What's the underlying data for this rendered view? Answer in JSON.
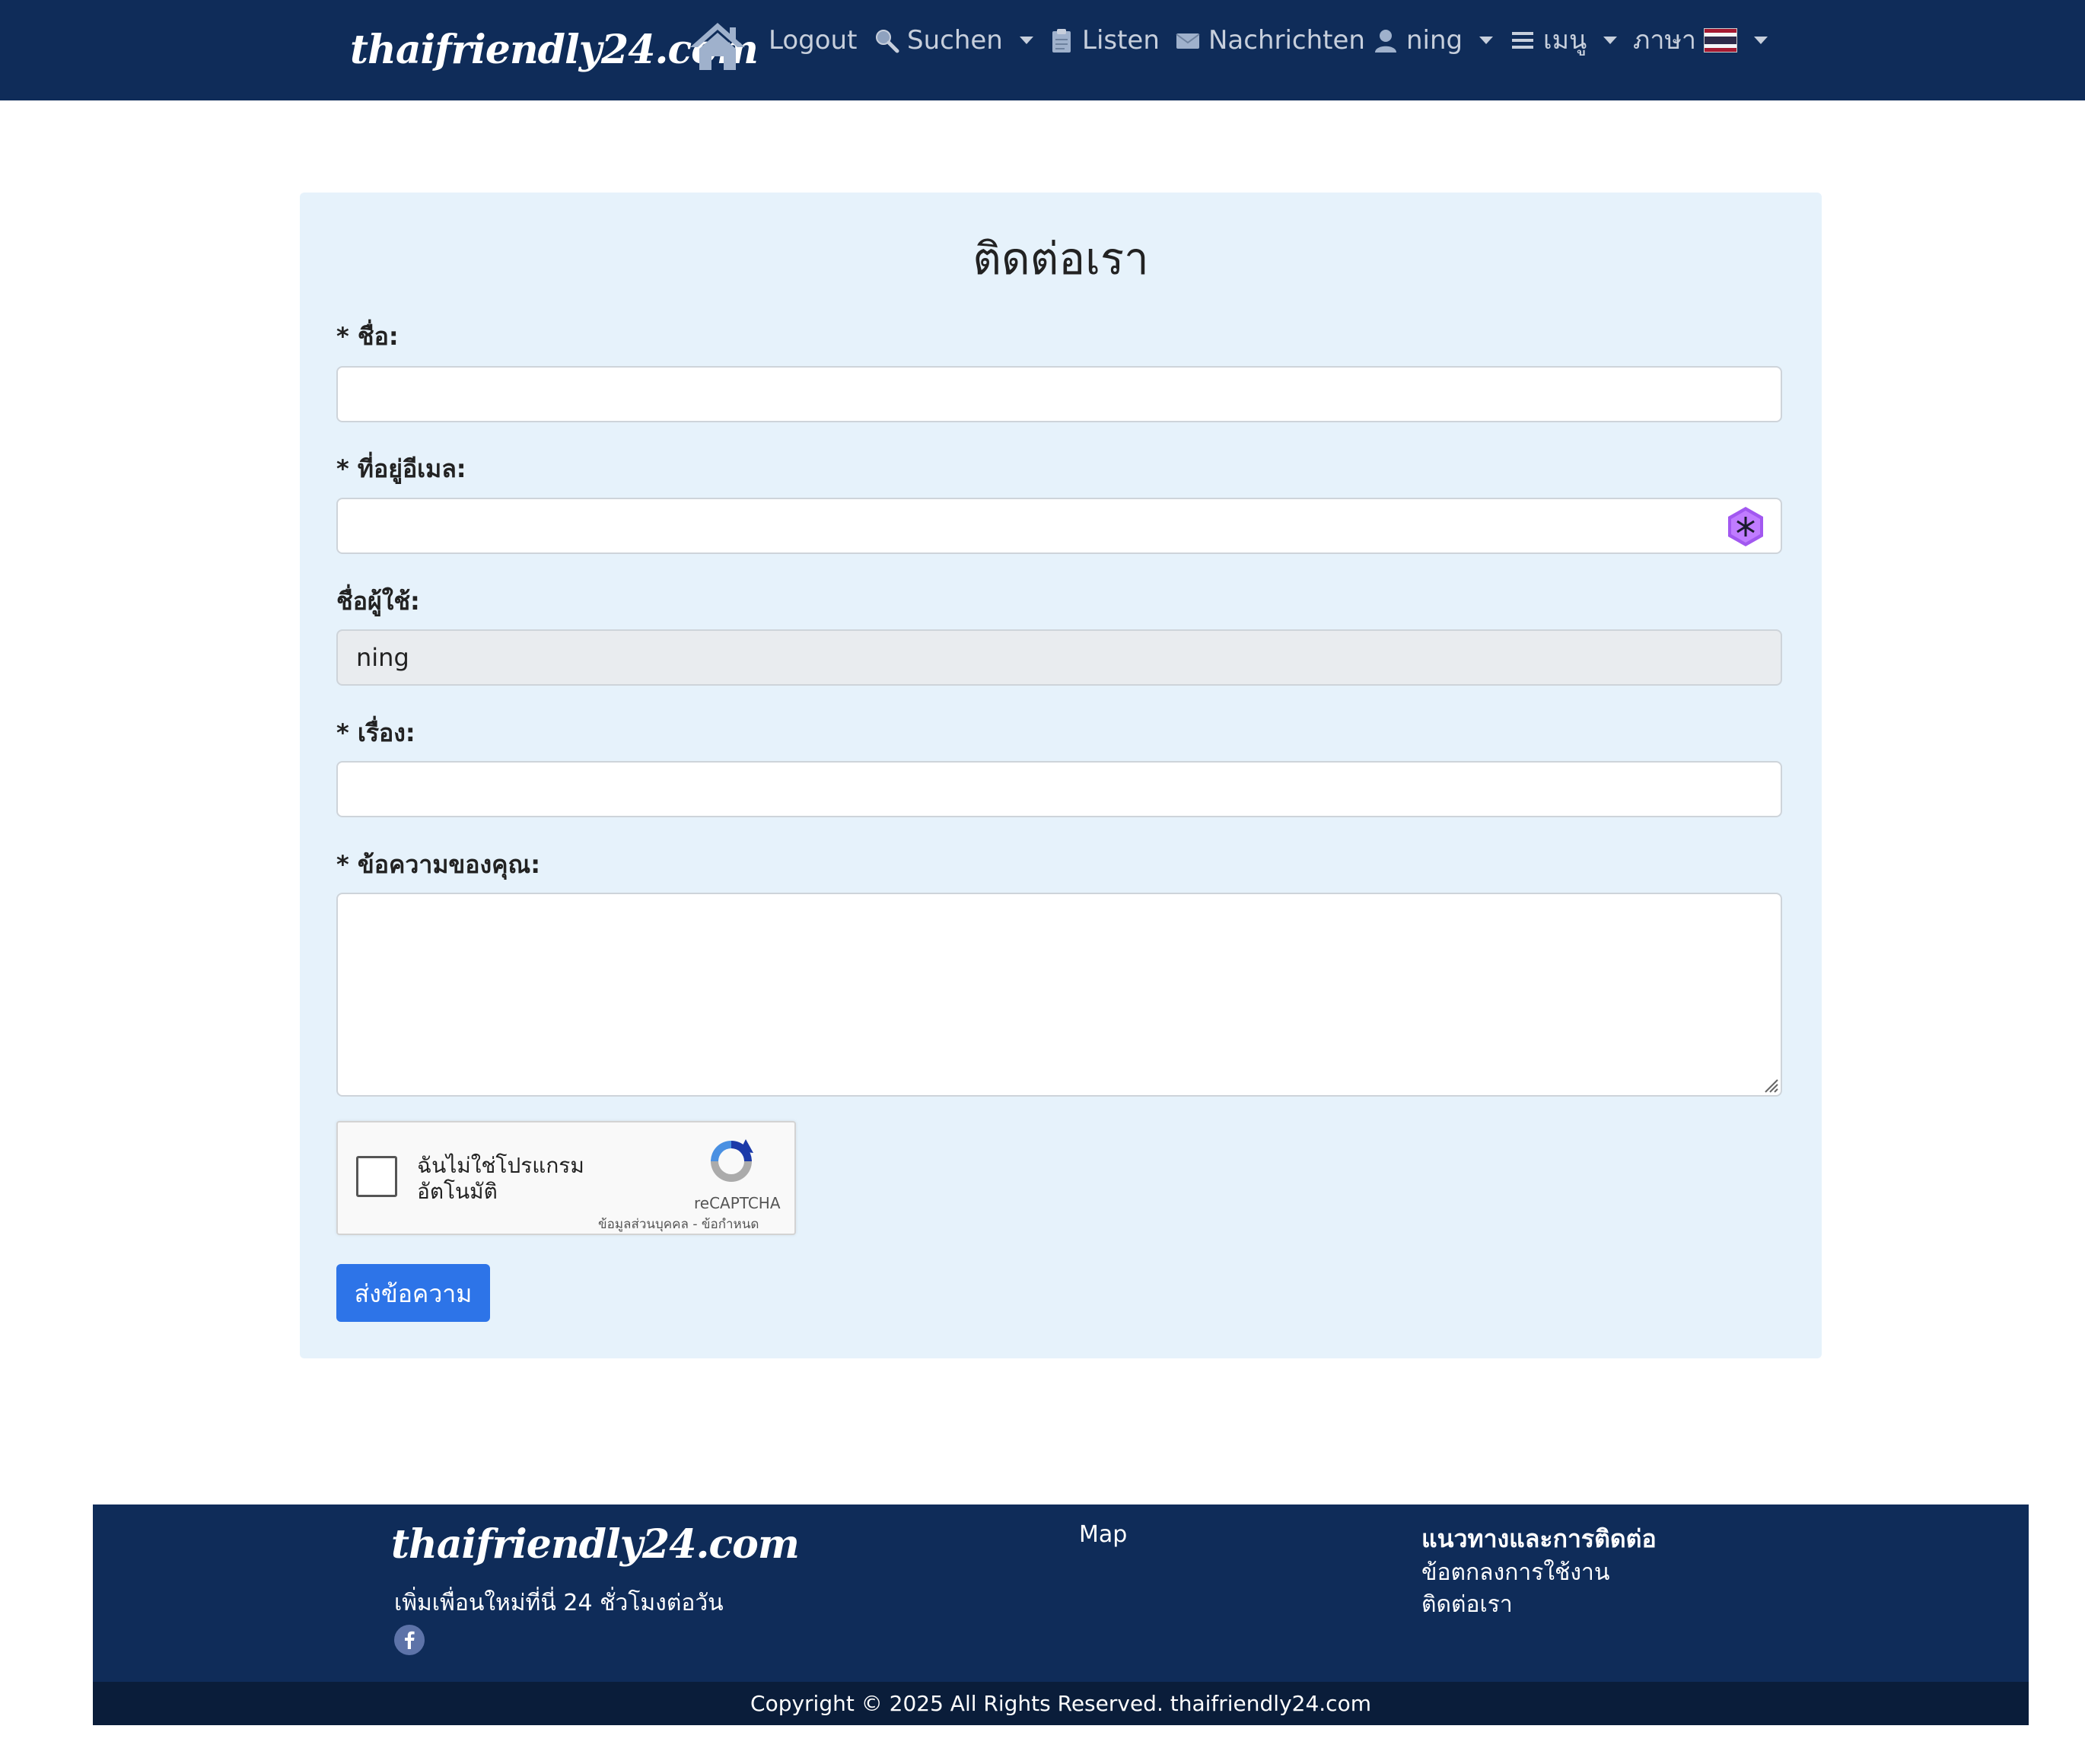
{
  "nav": {
    "brand": "thaifriendly24.com",
    "items": {
      "logout": "Logout",
      "search": "Suchen",
      "lists": "Listen",
      "messages": "Nachrichten",
      "user": "ning",
      "menu": "เมนู",
      "language": "ภาษา"
    },
    "icons": {
      "home": "home-icon",
      "search": "search-icon",
      "lists": "clipboard-icon",
      "messages": "envelope-icon",
      "user": "user-icon",
      "menu": "hamburger-icon",
      "language": "thai-flag-icon"
    }
  },
  "form": {
    "title": "ติดต่อเรา",
    "fields": {
      "name": {
        "label": "* ชื่อ:",
        "value": ""
      },
      "email": {
        "label": "* ที่อยู่อีเมล:",
        "value": ""
      },
      "username": {
        "label": "ชื่อผู้ใช้:",
        "value": "ning"
      },
      "subject": {
        "label": "* เรื่อง:",
        "value": ""
      },
      "message": {
        "label": "* ข้อความของคุณ:",
        "value": ""
      }
    },
    "recaptcha": {
      "label_line1": "ฉันไม่ใช่โปรแกรม",
      "label_line2": "อัตโนมัติ",
      "brand": "reCAPTCHA",
      "links": "ข้อมูลส่วนบุคคล - ข้อกำหนด"
    },
    "submit_label": "ส่งข้อความ"
  },
  "footer": {
    "brand": "thaifriendly24.com",
    "tagline": "เพิ่มเพื่อนใหม่ที่นี่ 24 ชั่วโมงต่อวัน",
    "map_link": "Map",
    "guidelines_heading": "แนวทางและการติดต่อ",
    "terms_link": "ข้อตกลงการใช้งาน",
    "contact_link": "ติดต่อเรา",
    "copyright": "Copyright © 2025 All Rights Reserved. thaifriendly24.com"
  },
  "colors": {
    "navbar": "#0f2c59",
    "card": "#e6f2fb",
    "primary_button": "#2d74e8",
    "footer_bottom": "#0a1d3a"
  }
}
